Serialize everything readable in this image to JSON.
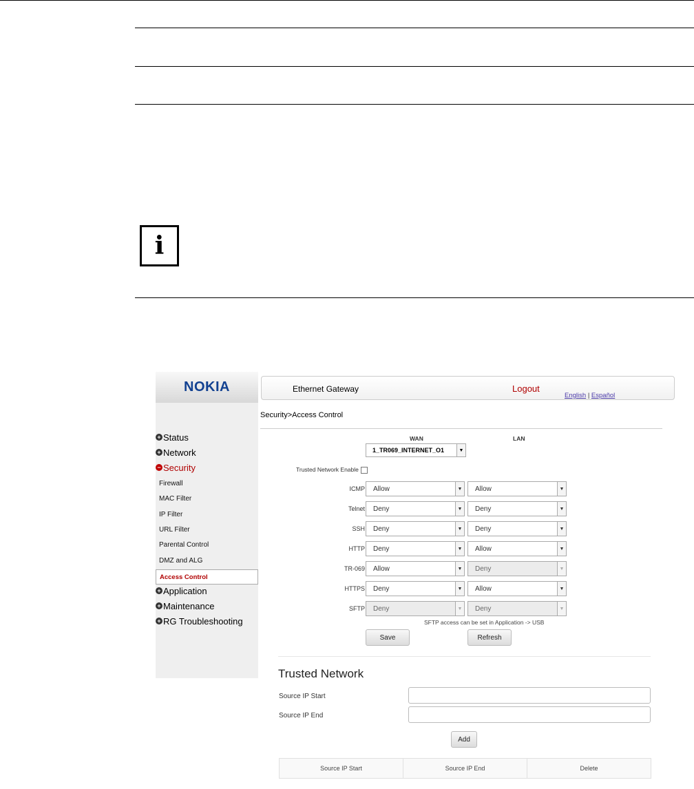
{
  "info_icon": "info-icon",
  "app": {
    "logo": "NOKIA",
    "title": "Ethernet Gateway",
    "logout": "Logout",
    "lang_english": "English",
    "lang_sep": "|",
    "lang_spanish": "Español",
    "breadcrumb": "Security>Access Control"
  },
  "sidebar": {
    "items": [
      {
        "label": "Status",
        "state": "collapsed"
      },
      {
        "label": "Network",
        "state": "collapsed"
      },
      {
        "label": "Security",
        "state": "expanded"
      },
      {
        "label": "Application",
        "state": "collapsed"
      },
      {
        "label": "Maintenance",
        "state": "collapsed"
      },
      {
        "label": "RG Troubleshooting",
        "state": "collapsed"
      }
    ],
    "security_sub": [
      "Firewall",
      "MAC Filter",
      "IP Filter",
      "URL Filter",
      "Parental Control",
      "DMZ and ALG",
      "Access Control"
    ]
  },
  "access": {
    "wan_header": "WAN",
    "lan_header": "LAN",
    "wan_select": "1_TR069_INTERNET_O1",
    "trusted_enable": "Trusted Network Enable",
    "rows": [
      {
        "label": "ICMP",
        "wan": "Allow",
        "lan": "Allow",
        "wan_disabled": false,
        "lan_disabled": false
      },
      {
        "label": "Telnet",
        "wan": "Deny",
        "lan": "Deny",
        "wan_disabled": false,
        "lan_disabled": false
      },
      {
        "label": "SSH",
        "wan": "Deny",
        "lan": "Deny",
        "wan_disabled": false,
        "lan_disabled": false
      },
      {
        "label": "HTTP",
        "wan": "Deny",
        "lan": "Allow",
        "wan_disabled": false,
        "lan_disabled": false
      },
      {
        "label": "TR-069",
        "wan": "Allow",
        "lan": "Deny",
        "wan_disabled": false,
        "lan_disabled": true
      },
      {
        "label": "HTTPS",
        "wan": "Deny",
        "lan": "Allow",
        "wan_disabled": false,
        "lan_disabled": false
      },
      {
        "label": "SFTP",
        "wan": "Deny",
        "lan": "Deny",
        "wan_disabled": true,
        "lan_disabled": true
      }
    ],
    "sftp_note": "SFTP access can be set in Application -> USB",
    "save": "Save",
    "refresh": "Refresh"
  },
  "trusted": {
    "heading": "Trusted Network",
    "start_label": "Source IP Start",
    "end_label": "Source IP End",
    "start_value": "",
    "end_value": "",
    "add": "Add",
    "columns": [
      "Source IP Start",
      "Source IP End",
      "Delete"
    ]
  }
}
